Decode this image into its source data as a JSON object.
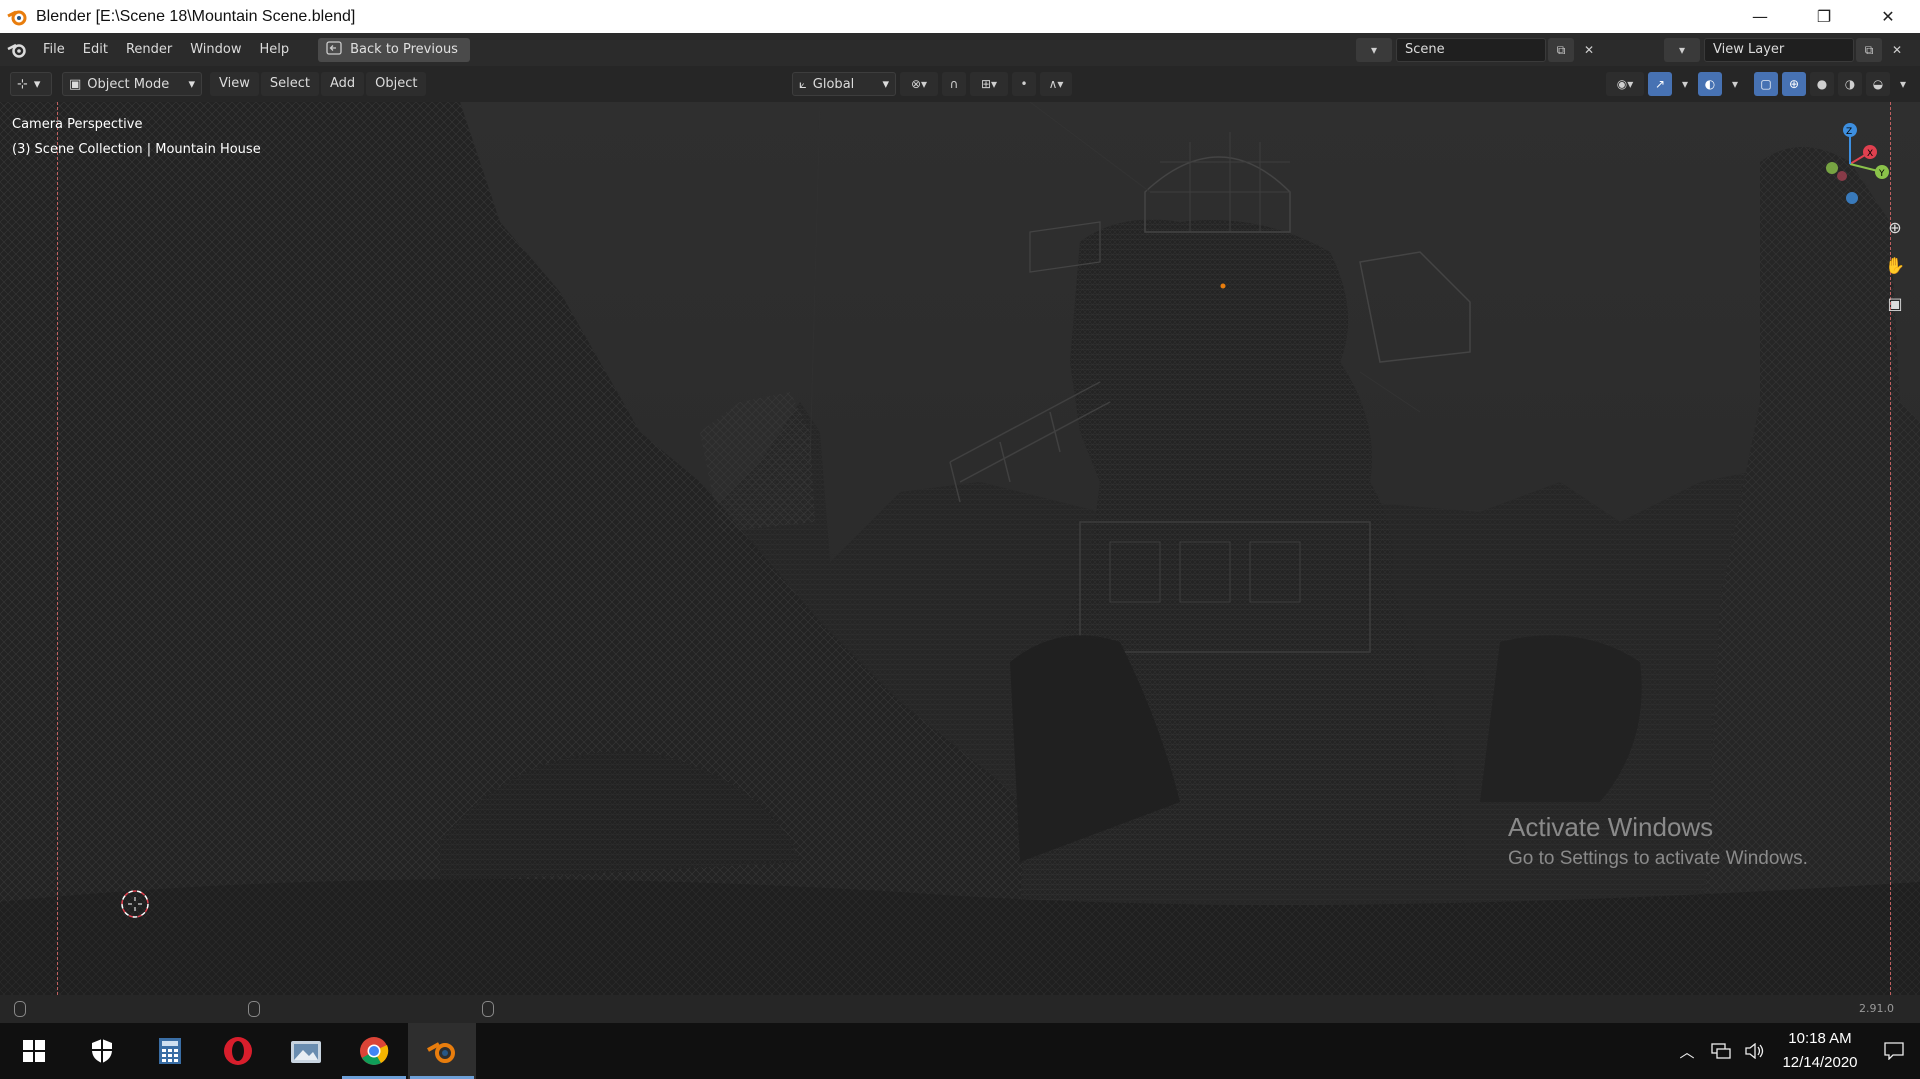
{
  "window": {
    "title": "Blender [E:\\Scene 18\\Mountain Scene.blend]",
    "controls": {
      "minimize": "—",
      "restore": "❐",
      "close": "✕"
    }
  },
  "menubar": {
    "items": [
      "File",
      "Edit",
      "Render",
      "Window",
      "Help"
    ],
    "back_label": "Back to Previous",
    "scene_label": "Scene",
    "view_layer_label": "View Layer"
  },
  "viewport_header": {
    "mode": "Object Mode",
    "menus": [
      "View",
      "Select",
      "Add",
      "Object"
    ],
    "transform_orientation": "Global"
  },
  "viewport": {
    "camera_label": "Camera Perspective",
    "collection_label": "(3) Scene Collection | Mountain House",
    "gizmo_axes": {
      "x": "X",
      "y": "Y",
      "z": "Z"
    }
  },
  "watermark": {
    "title": "Activate Windows",
    "subtitle": "Go to Settings to activate Windows."
  },
  "statusbar": {
    "version": "2.91.0"
  },
  "taskbar": {
    "apps": [
      "start-icon",
      "security-icon",
      "calculator-icon",
      "opera-icon",
      "photos-icon",
      "chrome-icon",
      "blender-icon"
    ],
    "time": "10:18 AM",
    "date": "12/14/2020"
  },
  "colors": {
    "accent": "#4772b3",
    "blender_orange": "#e87d0d",
    "axis_x": "#e0404f",
    "axis_y": "#8bc34a",
    "axis_z": "#3d8fe0"
  }
}
